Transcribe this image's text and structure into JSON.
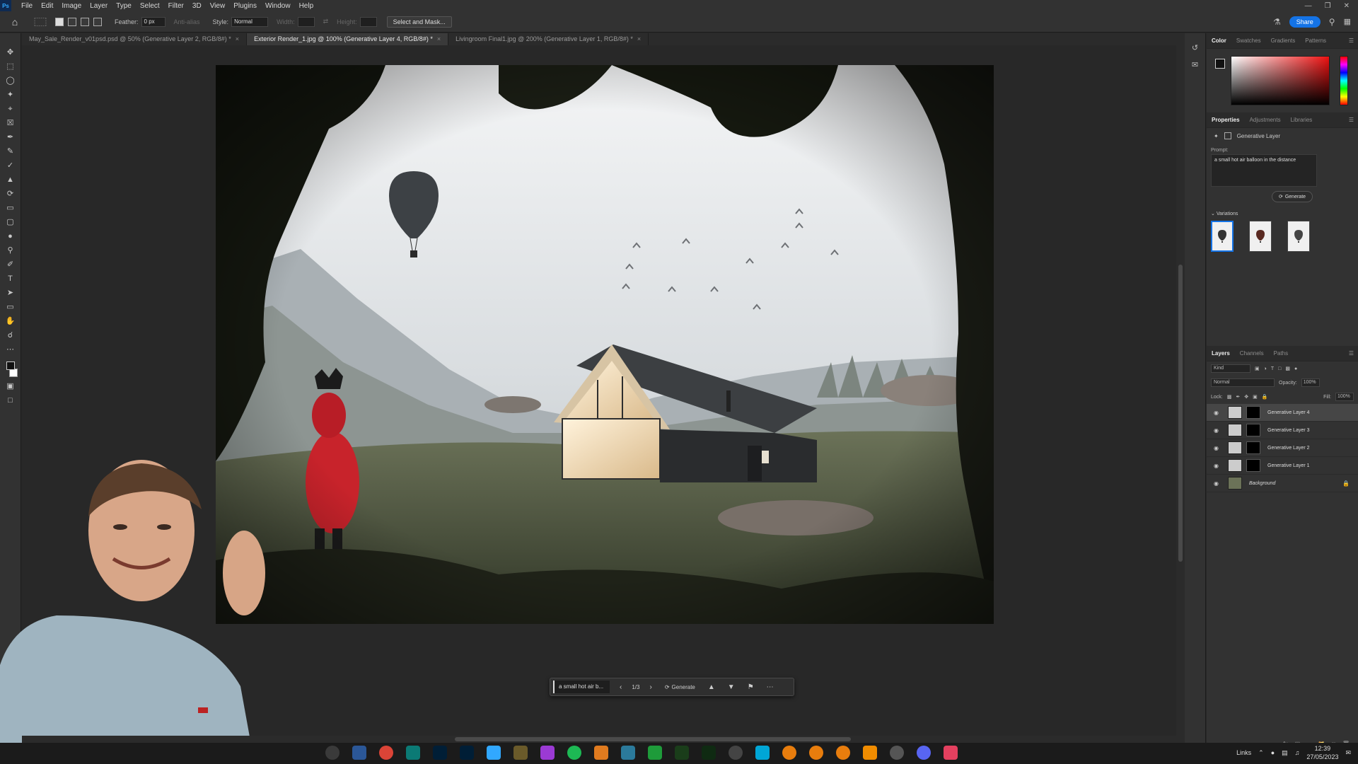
{
  "menubar": {
    "logo": "Ps",
    "items": [
      "File",
      "Edit",
      "Image",
      "Layer",
      "Type",
      "Select",
      "Filter",
      "3D",
      "View",
      "Plugins",
      "Window",
      "Help"
    ]
  },
  "options": {
    "feather_label": "Feather:",
    "feather_value": "0 px",
    "antialias_label": "Anti-alias",
    "style_label": "Style:",
    "style_value": "Normal",
    "width_label": "Width:",
    "height_label": "Height:",
    "select_mask": "Select and Mask...",
    "share": "Share"
  },
  "doctabs": [
    {
      "label": "May_Sale_Render_v01psd.psd @ 50% (Generative Layer 2, RGB/8#) *",
      "active": false
    },
    {
      "label": "Exterior Render_1.jpg @ 100% (Generative Layer 4, RGB/8#) *",
      "active": true
    },
    {
      "label": "Livingroom Final1.jpg @ 200% (Generative Layer 1, RGB/8#) *",
      "active": false
    }
  ],
  "context_bar": {
    "prompt": "a small hot air b...",
    "counter": "1/3",
    "generate": "Generate"
  },
  "color_panel": {
    "tabs": [
      "Color",
      "Swatches",
      "Gradients",
      "Patterns"
    ]
  },
  "properties": {
    "tabs": [
      "Properties",
      "Adjustments",
      "Libraries"
    ],
    "layer_type": "Generative Layer",
    "prompt_label": "Prompt:",
    "prompt": "a small hot air balloon in the distance",
    "generate": "Generate",
    "variations_label": "Variations"
  },
  "layers": {
    "tabs": [
      "Layers",
      "Channels",
      "Paths"
    ],
    "kind": "Kind",
    "blend": "Normal",
    "opacity_label": "Opacity:",
    "opacity": "100%",
    "lock_label": "Lock:",
    "fill_label": "Fill:",
    "fill": "100%",
    "items": [
      {
        "name": "Generative Layer 4",
        "selected": true
      },
      {
        "name": "Generative Layer 3",
        "selected": false
      },
      {
        "name": "Generative Layer 2",
        "selected": false
      },
      {
        "name": "Generative Layer 1",
        "selected": false
      },
      {
        "name": "Background",
        "selected": false
      }
    ]
  },
  "taskbar": {
    "links": "Links",
    "time": "12:39",
    "date": "27/05/2023"
  },
  "colors": {
    "accent": "#1473e6",
    "panel_bg": "#323232",
    "canvas_bg": "#282828"
  }
}
